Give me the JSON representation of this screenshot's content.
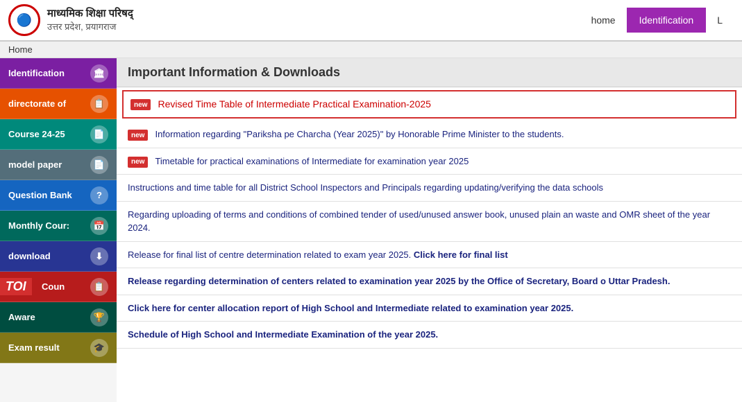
{
  "header": {
    "logo_text_line1": "माध्यमिक शिक्षा परिषद्",
    "logo_text_line2": "उत्तर प्रदेश, प्रयागराज",
    "nav_home": "home",
    "nav_identification": "Identification",
    "nav_extra": "L"
  },
  "breadcrumb": "Home",
  "sidebar": {
    "items": [
      {
        "label": "Identification",
        "icon": "🏛",
        "color": "purple"
      },
      {
        "label": "directorate of",
        "icon": "📋",
        "color": "orange"
      },
      {
        "label": "Course 24-25",
        "icon": "📄",
        "color": "blue-green"
      },
      {
        "label": "model paper",
        "icon": "📄",
        "color": "dark-gray"
      },
      {
        "label": "Question Bank",
        "icon": "?",
        "color": "blue-dark"
      },
      {
        "label": "Monthly Cour:",
        "icon": "📅",
        "color": "teal"
      },
      {
        "label": "download",
        "icon": "⬇",
        "color": "dark-blue"
      },
      {
        "label": "Coun",
        "icon": "📋",
        "color": "dark-red"
      },
      {
        "label": "Aware",
        "icon": "🏆",
        "color": "dark-teal"
      },
      {
        "label": "Exam result",
        "icon": "🎓",
        "color": "yellow-green"
      }
    ]
  },
  "content": {
    "section_title": "Important Information & Downloads",
    "items": [
      {
        "id": 1,
        "is_new": true,
        "highlighted": true,
        "text": "Revised Time Table of Intermediate Practical Examination-2025",
        "bold": false
      },
      {
        "id": 2,
        "is_new": true,
        "highlighted": false,
        "text": "Information regarding \"Pariksha pe Charcha (Year 2025)\" by Honorable Prime Minister to the students.",
        "bold": false
      },
      {
        "id": 3,
        "is_new": true,
        "highlighted": false,
        "text": "Timetable for practical examinations of Intermediate for examination year 2025",
        "bold": false
      },
      {
        "id": 4,
        "is_new": false,
        "highlighted": false,
        "text": "Instructions and time table for all District School Inspectors and Principals regarding updating/verifying the data schools",
        "bold": false
      },
      {
        "id": 5,
        "is_new": false,
        "highlighted": false,
        "text": "Regarding uploading of terms and conditions of combined tender of used/unused answer book, unused plain and waste and OMR sheet of the year 2024.",
        "bold": false
      },
      {
        "id": 6,
        "is_new": false,
        "highlighted": false,
        "text": "Release for final list of centre determination related to exam year 2025.",
        "suffix_bold": "Click here for final list",
        "bold": false
      },
      {
        "id": 7,
        "is_new": false,
        "highlighted": false,
        "text": "Release regarding determination of centers related to examination year 2025 by the Office of Secretary, Board of Uttar Pradesh.",
        "bold": true
      },
      {
        "id": 8,
        "is_new": false,
        "highlighted": false,
        "text": "Click here for center allocation report of High School and Intermediate related to examination year 2025.",
        "bold": true
      },
      {
        "id": 9,
        "is_new": false,
        "highlighted": false,
        "text": "Schedule of High School and Intermediate Examination of the year 2025.",
        "bold": true
      }
    ]
  }
}
